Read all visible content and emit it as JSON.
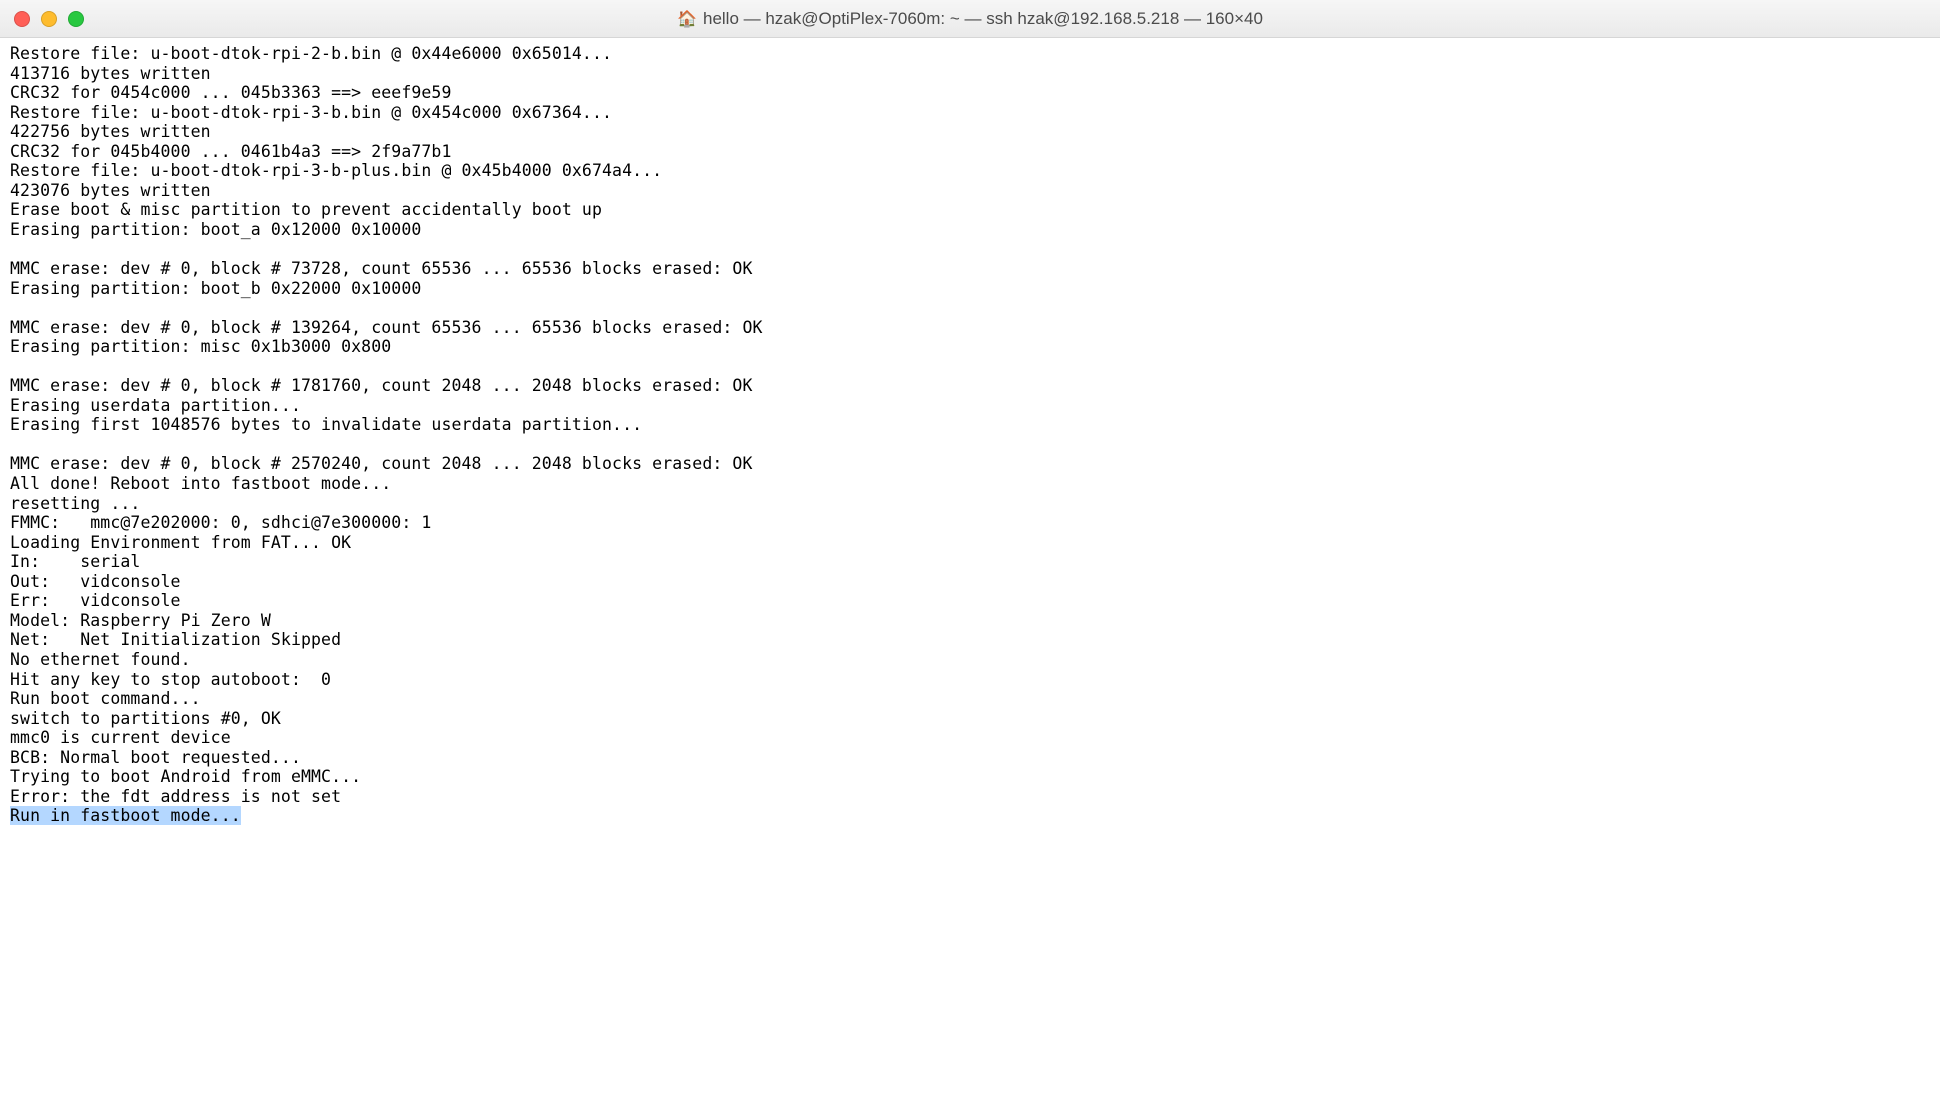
{
  "window": {
    "title": "hello — hzak@OptiPlex-7060m: ~ — ssh hzak@192.168.5.218 — 160×40",
    "home_icon": "🏠"
  },
  "terminal": {
    "lines": [
      "Restore file: u-boot-dtok-rpi-2-b.bin @ 0x44e6000 0x65014...",
      "413716 bytes written",
      "CRC32 for 0454c000 ... 045b3363 ==> eeef9e59",
      "Restore file: u-boot-dtok-rpi-3-b.bin @ 0x454c000 0x67364...",
      "422756 bytes written",
      "CRC32 for 045b4000 ... 0461b4a3 ==> 2f9a77b1",
      "Restore file: u-boot-dtok-rpi-3-b-plus.bin @ 0x45b4000 0x674a4...",
      "423076 bytes written",
      "Erase boot & misc partition to prevent accidentally boot up",
      "Erasing partition: boot_a 0x12000 0x10000",
      "",
      "MMC erase: dev # 0, block # 73728, count 65536 ... 65536 blocks erased: OK",
      "Erasing partition: boot_b 0x22000 0x10000",
      "",
      "MMC erase: dev # 0, block # 139264, count 65536 ... 65536 blocks erased: OK",
      "Erasing partition: misc 0x1b3000 0x800",
      "",
      "MMC erase: dev # 0, block # 1781760, count 2048 ... 2048 blocks erased: OK",
      "Erasing userdata partition...",
      "Erasing first 1048576 bytes to invalidate userdata partition...",
      "",
      "MMC erase: dev # 0, block # 2570240, count 2048 ... 2048 blocks erased: OK",
      "All done! Reboot into fastboot mode...",
      "resetting ...",
      "FMMC:   mmc@7e202000: 0, sdhci@7e300000: 1",
      "Loading Environment from FAT... OK",
      "In:    serial",
      "Out:   vidconsole",
      "Err:   vidconsole",
      "Model: Raspberry Pi Zero W",
      "Net:   Net Initialization Skipped",
      "No ethernet found.",
      "Hit any key to stop autoboot:  0",
      "Run boot command...",
      "switch to partitions #0, OK",
      "mmc0 is current device",
      "BCB: Normal boot requested...",
      "Trying to boot Android from eMMC...",
      "Error: the fdt address is not set"
    ],
    "highlighted_line": "Run in fastboot mode..."
  }
}
